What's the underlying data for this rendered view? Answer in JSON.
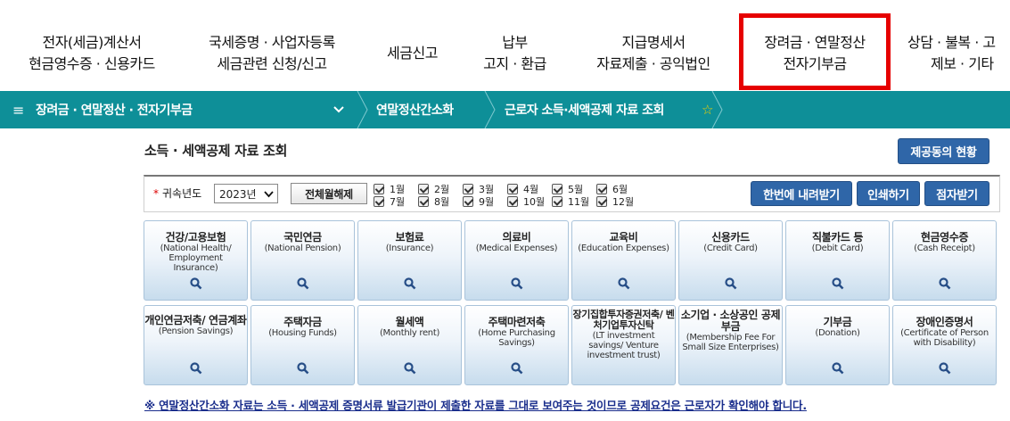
{
  "top_nav": [
    {
      "line1": "전자(세금)계산서",
      "line2": "현금영수증 · 신용카드"
    },
    {
      "line1": "국세증명 · 사업자등록",
      "line2": "세금관련 신청/신고"
    },
    {
      "line1": "세금신고",
      "line2": ""
    },
    {
      "line1": "납부",
      "line2": "고지 · 환급"
    },
    {
      "line1": "지급명세서",
      "line2": "자료제출 · 공익법인"
    },
    {
      "line1": "장려금 · 연말정산",
      "line2": "전자기부금"
    },
    {
      "line1": "상담 · 불복 · 고",
      "line2": "제보 · 기타"
    }
  ],
  "breadcrumb": {
    "menu_icon": "≡",
    "section": "장려금 · 연말정산 · 전자기부금",
    "level2": "연말정산간소화",
    "level3": "근로자 소득·세액공제 자료 조회",
    "favorite_icon": "☆"
  },
  "page": {
    "title": "소득 · 세액공제 자료 조회",
    "provider_button": "제공동의 현황"
  },
  "filter": {
    "year_label": "귀속년도",
    "year_value": "2023년",
    "toggle_all": "전체월해제",
    "months": [
      "1월",
      "2월",
      "3월",
      "4월",
      "5월",
      "6월",
      "7월",
      "8월",
      "9월",
      "10월",
      "11월",
      "12월"
    ],
    "download_button": "한번에 내려받기",
    "print_button": "인쇄하기",
    "braille_button": "점자받기"
  },
  "tiles_row1": [
    {
      "title": "건강/고용보험",
      "sub": "(National Health/ Employment Insurance)"
    },
    {
      "title": "국민연금",
      "sub": "(National Pension)"
    },
    {
      "title": "보험료",
      "sub": "(Insurance)"
    },
    {
      "title": "의료비",
      "sub": "(Medical Expenses)"
    },
    {
      "title": "교육비",
      "sub": "(Education Expenses)"
    },
    {
      "title": "신용카드",
      "sub": "(Credit Card)"
    },
    {
      "title": "직불카드 등",
      "sub": "(Debit Card)"
    },
    {
      "title": "현금영수증",
      "sub": "(Cash Receipt)"
    }
  ],
  "tiles_row2": [
    {
      "title": "개인연금저축/ 연금계좌",
      "sub": "(Pension Savings)"
    },
    {
      "title": "주택자금",
      "sub": "(Housing Funds)"
    },
    {
      "title": "월세액",
      "sub": "(Monthly rent)"
    },
    {
      "title": "주택마련저축",
      "sub": "(Home Purchasing Savings)"
    },
    {
      "title": "장기집합투자증권저축/ 벤처기업투자신탁",
      "sub": "(LT investment savings/ Venture investment trust)"
    },
    {
      "title": "소기업 · 소상공인 공제부금",
      "sub": "(Membership Fee For Small Size Enterprises)"
    },
    {
      "title": "기부금",
      "sub": "(Donation)"
    },
    {
      "title": "장애인증명서",
      "sub": "(Certificate of Person with Disability)"
    }
  ],
  "notice": "※ 연말정산간소화 자료는 소득 · 세액공제 증명서류 발급기관이 제출한 자료를 그대로 보여주는 것이므로 공제요건은 근로자가 확인해야 합니다.",
  "colors": {
    "bar": "#0e8f98",
    "button": "#2f66a8",
    "highlight": "#e60000"
  }
}
